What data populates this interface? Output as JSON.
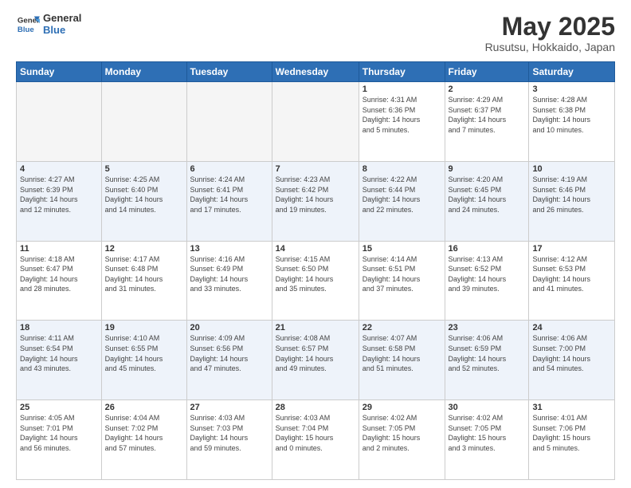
{
  "header": {
    "logo_line1": "General",
    "logo_line2": "Blue",
    "title": "May 2025",
    "subtitle": "Rusutsu, Hokkaido, Japan"
  },
  "weekdays": [
    "Sunday",
    "Monday",
    "Tuesday",
    "Wednesday",
    "Thursday",
    "Friday",
    "Saturday"
  ],
  "weeks": [
    [
      {
        "day": "",
        "info": "",
        "empty": true
      },
      {
        "day": "",
        "info": "",
        "empty": true
      },
      {
        "day": "",
        "info": "",
        "empty": true
      },
      {
        "day": "",
        "info": "",
        "empty": true
      },
      {
        "day": "1",
        "info": "Sunrise: 4:31 AM\nSunset: 6:36 PM\nDaylight: 14 hours\nand 5 minutes."
      },
      {
        "day": "2",
        "info": "Sunrise: 4:29 AM\nSunset: 6:37 PM\nDaylight: 14 hours\nand 7 minutes."
      },
      {
        "day": "3",
        "info": "Sunrise: 4:28 AM\nSunset: 6:38 PM\nDaylight: 14 hours\nand 10 minutes."
      }
    ],
    [
      {
        "day": "4",
        "info": "Sunrise: 4:27 AM\nSunset: 6:39 PM\nDaylight: 14 hours\nand 12 minutes."
      },
      {
        "day": "5",
        "info": "Sunrise: 4:25 AM\nSunset: 6:40 PM\nDaylight: 14 hours\nand 14 minutes."
      },
      {
        "day": "6",
        "info": "Sunrise: 4:24 AM\nSunset: 6:41 PM\nDaylight: 14 hours\nand 17 minutes."
      },
      {
        "day": "7",
        "info": "Sunrise: 4:23 AM\nSunset: 6:42 PM\nDaylight: 14 hours\nand 19 minutes."
      },
      {
        "day": "8",
        "info": "Sunrise: 4:22 AM\nSunset: 6:44 PM\nDaylight: 14 hours\nand 22 minutes."
      },
      {
        "day": "9",
        "info": "Sunrise: 4:20 AM\nSunset: 6:45 PM\nDaylight: 14 hours\nand 24 minutes."
      },
      {
        "day": "10",
        "info": "Sunrise: 4:19 AM\nSunset: 6:46 PM\nDaylight: 14 hours\nand 26 minutes."
      }
    ],
    [
      {
        "day": "11",
        "info": "Sunrise: 4:18 AM\nSunset: 6:47 PM\nDaylight: 14 hours\nand 28 minutes."
      },
      {
        "day": "12",
        "info": "Sunrise: 4:17 AM\nSunset: 6:48 PM\nDaylight: 14 hours\nand 31 minutes."
      },
      {
        "day": "13",
        "info": "Sunrise: 4:16 AM\nSunset: 6:49 PM\nDaylight: 14 hours\nand 33 minutes."
      },
      {
        "day": "14",
        "info": "Sunrise: 4:15 AM\nSunset: 6:50 PM\nDaylight: 14 hours\nand 35 minutes."
      },
      {
        "day": "15",
        "info": "Sunrise: 4:14 AM\nSunset: 6:51 PM\nDaylight: 14 hours\nand 37 minutes."
      },
      {
        "day": "16",
        "info": "Sunrise: 4:13 AM\nSunset: 6:52 PM\nDaylight: 14 hours\nand 39 minutes."
      },
      {
        "day": "17",
        "info": "Sunrise: 4:12 AM\nSunset: 6:53 PM\nDaylight: 14 hours\nand 41 minutes."
      }
    ],
    [
      {
        "day": "18",
        "info": "Sunrise: 4:11 AM\nSunset: 6:54 PM\nDaylight: 14 hours\nand 43 minutes."
      },
      {
        "day": "19",
        "info": "Sunrise: 4:10 AM\nSunset: 6:55 PM\nDaylight: 14 hours\nand 45 minutes."
      },
      {
        "day": "20",
        "info": "Sunrise: 4:09 AM\nSunset: 6:56 PM\nDaylight: 14 hours\nand 47 minutes."
      },
      {
        "day": "21",
        "info": "Sunrise: 4:08 AM\nSunset: 6:57 PM\nDaylight: 14 hours\nand 49 minutes."
      },
      {
        "day": "22",
        "info": "Sunrise: 4:07 AM\nSunset: 6:58 PM\nDaylight: 14 hours\nand 51 minutes."
      },
      {
        "day": "23",
        "info": "Sunrise: 4:06 AM\nSunset: 6:59 PM\nDaylight: 14 hours\nand 52 minutes."
      },
      {
        "day": "24",
        "info": "Sunrise: 4:06 AM\nSunset: 7:00 PM\nDaylight: 14 hours\nand 54 minutes."
      }
    ],
    [
      {
        "day": "25",
        "info": "Sunrise: 4:05 AM\nSunset: 7:01 PM\nDaylight: 14 hours\nand 56 minutes."
      },
      {
        "day": "26",
        "info": "Sunrise: 4:04 AM\nSunset: 7:02 PM\nDaylight: 14 hours\nand 57 minutes."
      },
      {
        "day": "27",
        "info": "Sunrise: 4:03 AM\nSunset: 7:03 PM\nDaylight: 14 hours\nand 59 minutes."
      },
      {
        "day": "28",
        "info": "Sunrise: 4:03 AM\nSunset: 7:04 PM\nDaylight: 15 hours\nand 0 minutes."
      },
      {
        "day": "29",
        "info": "Sunrise: 4:02 AM\nSunset: 7:05 PM\nDaylight: 15 hours\nand 2 minutes."
      },
      {
        "day": "30",
        "info": "Sunrise: 4:02 AM\nSunset: 7:05 PM\nDaylight: 15 hours\nand 3 minutes."
      },
      {
        "day": "31",
        "info": "Sunrise: 4:01 AM\nSunset: 7:06 PM\nDaylight: 15 hours\nand 5 minutes."
      }
    ]
  ]
}
